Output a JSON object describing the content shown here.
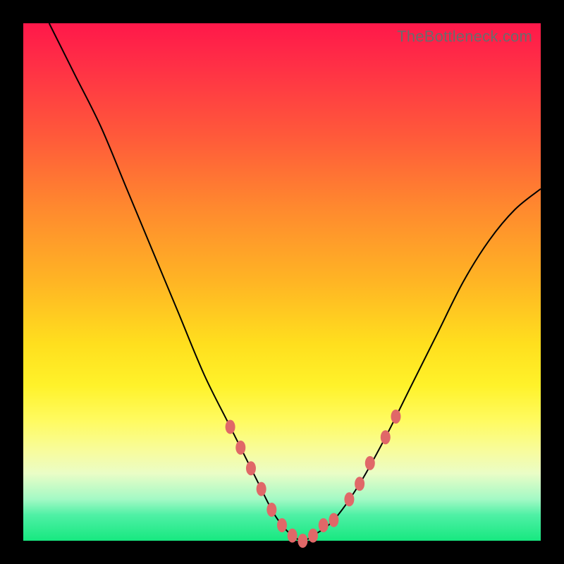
{
  "watermark": "TheBottleneck.com",
  "colors": {
    "background": "#000000",
    "gradient_top": "#ff184a",
    "gradient_bottom": "#17e880",
    "curve": "#000000",
    "beads": "#e06868"
  },
  "chart_data": {
    "type": "line",
    "title": "",
    "xlabel": "",
    "ylabel": "",
    "xlim": [
      0,
      100
    ],
    "ylim": [
      0,
      100
    ],
    "series": [
      {
        "name": "bottleneck-curve",
        "x": [
          5,
          10,
          15,
          20,
          25,
          30,
          35,
          40,
          45,
          48,
          50,
          52,
          54,
          56,
          60,
          65,
          70,
          75,
          80,
          85,
          90,
          95,
          100
        ],
        "y": [
          100,
          90,
          80,
          68,
          56,
          44,
          32,
          22,
          12,
          6,
          3,
          1,
          0,
          1,
          4,
          11,
          20,
          30,
          40,
          50,
          58,
          64,
          68
        ]
      }
    ],
    "markers": [
      {
        "name": "left-bead-1",
        "x": 40,
        "y": 22
      },
      {
        "name": "left-bead-2",
        "x": 42,
        "y": 18
      },
      {
        "name": "left-bead-3",
        "x": 44,
        "y": 14
      },
      {
        "name": "left-bead-4",
        "x": 46,
        "y": 10
      },
      {
        "name": "left-bead-5",
        "x": 48,
        "y": 6
      },
      {
        "name": "vertex-1",
        "x": 50,
        "y": 3
      },
      {
        "name": "vertex-2",
        "x": 52,
        "y": 1
      },
      {
        "name": "vertex-3",
        "x": 54,
        "y": 0
      },
      {
        "name": "vertex-4",
        "x": 56,
        "y": 1
      },
      {
        "name": "right-bead-1",
        "x": 58,
        "y": 3
      },
      {
        "name": "right-bead-2",
        "x": 60,
        "y": 4
      },
      {
        "name": "right-bead-3",
        "x": 63,
        "y": 8
      },
      {
        "name": "right-bead-4",
        "x": 65,
        "y": 11
      },
      {
        "name": "right-bead-5",
        "x": 67,
        "y": 15
      },
      {
        "name": "right-bead-6",
        "x": 70,
        "y": 20
      },
      {
        "name": "right-bead-7",
        "x": 72,
        "y": 24
      }
    ]
  }
}
